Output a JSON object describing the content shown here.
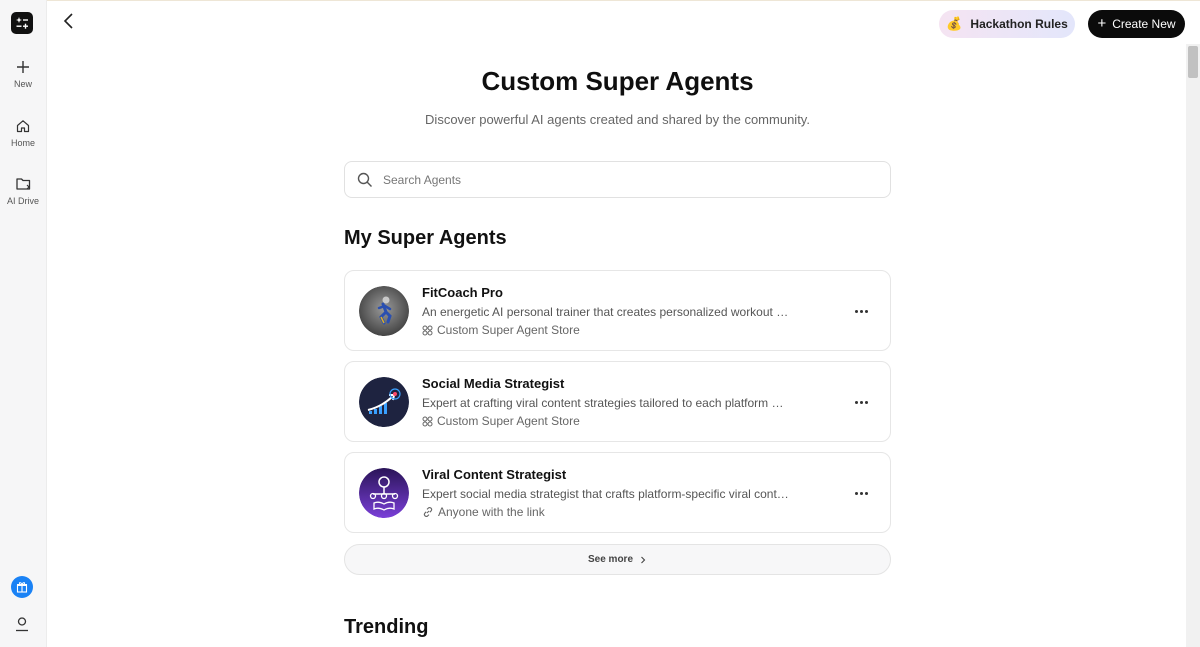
{
  "sidebar": {
    "items": [
      {
        "label": "New",
        "icon": "plus-icon"
      },
      {
        "label": "Home",
        "icon": "home-icon"
      },
      {
        "label": "AI Drive",
        "icon": "folder-icon"
      }
    ]
  },
  "header": {
    "hackathon_label": "Hackathon Rules",
    "hackathon_icon": "money-bag-icon",
    "create_label": "Create New"
  },
  "main": {
    "title": "Custom Super Agents",
    "subtitle": "Discover powerful AI agents created and shared by the community.",
    "search_placeholder": "Search Agents",
    "my_agents_heading": "My Super Agents",
    "agents": [
      {
        "name": "FitCoach Pro",
        "description": "An energetic AI personal trainer that creates personalized workout plans, motivates users, and tracks fitness progress",
        "meta": "Custom Super Agent Store",
        "meta_icon": "store-icon"
      },
      {
        "name": "Social Media Strategist",
        "description": "Expert at crafting viral content strategies tailored to each platform with data-driven insights",
        "meta": "Custom Super Agent Store",
        "meta_icon": "store-icon"
      },
      {
        "name": "Viral Content Strategist",
        "description": "Expert social media strategist that crafts platform-specific viral content strategies",
        "meta": "Anyone with the link",
        "meta_icon": "link-icon"
      }
    ],
    "see_more_label": "See more",
    "trending_heading": "Trending"
  },
  "colors": {
    "accent_blue": "#1a82f5",
    "button_dark": "#0b0b0b"
  }
}
